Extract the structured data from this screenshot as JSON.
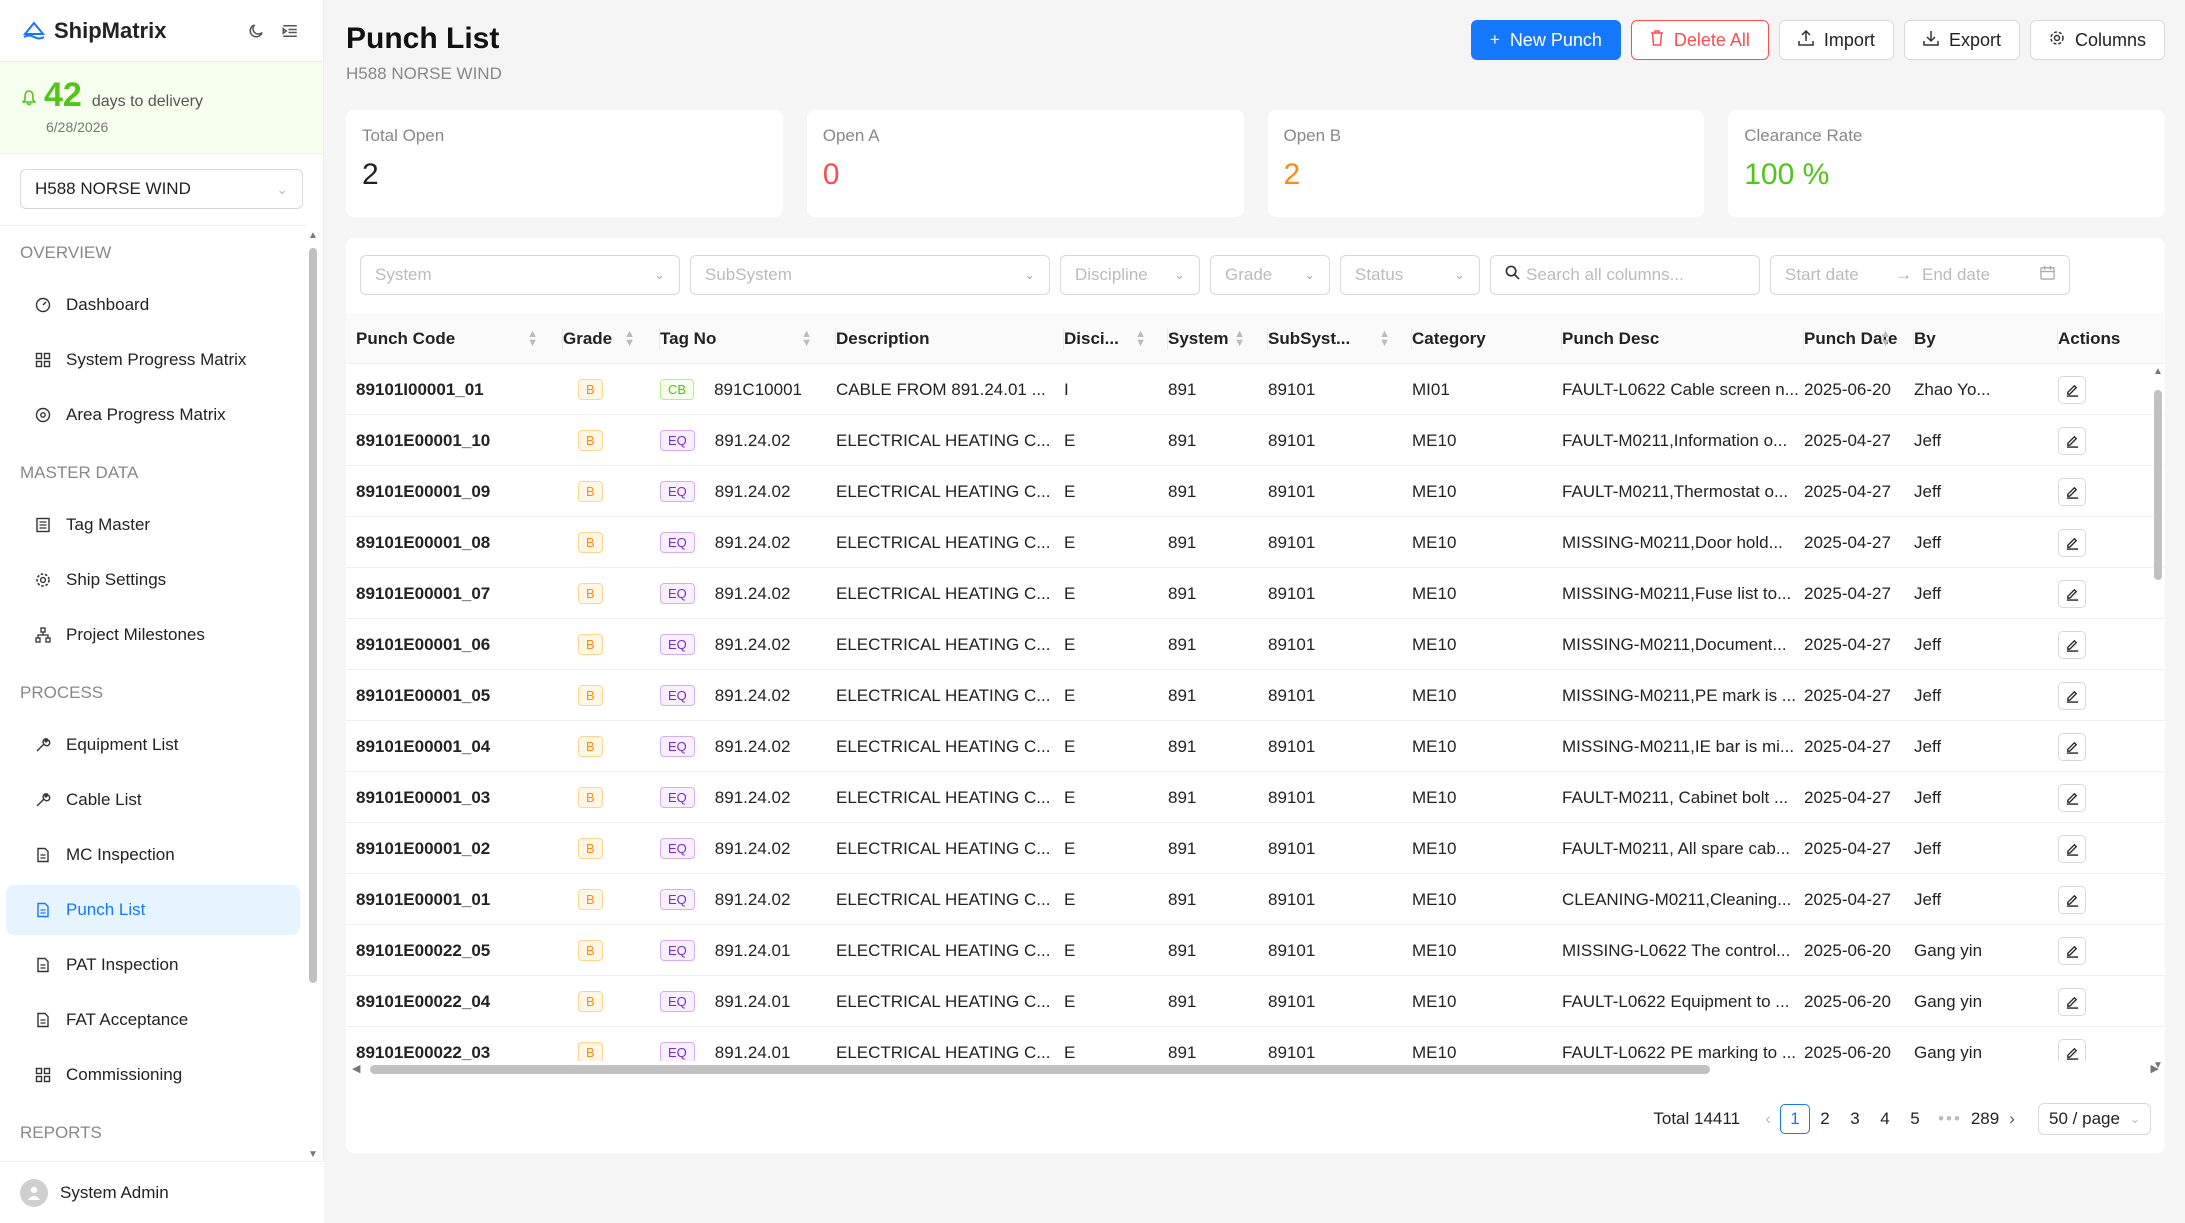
{
  "app": {
    "name": "ShipMatrix"
  },
  "delivery": {
    "days": "42",
    "label": "days to delivery",
    "date": "6/28/2026"
  },
  "ship_select": {
    "value": "H588 NORSE WIND"
  },
  "nav": {
    "sections": [
      {
        "label": "OVERVIEW",
        "items": [
          {
            "label": "Dashboard",
            "icon": "dashboard-icon"
          },
          {
            "label": "System Progress Matrix",
            "icon": "grid-icon"
          },
          {
            "label": "Area Progress Matrix",
            "icon": "location-icon"
          }
        ]
      },
      {
        "label": "MASTER DATA",
        "items": [
          {
            "label": "Tag Master",
            "icon": "list-icon"
          },
          {
            "label": "Ship Settings",
            "icon": "gear-icon"
          },
          {
            "label": "Project Milestones",
            "icon": "hierarchy-icon"
          }
        ]
      },
      {
        "label": "PROCESS",
        "items": [
          {
            "label": "Equipment List",
            "icon": "tool-icon"
          },
          {
            "label": "Cable List",
            "icon": "tool-icon"
          },
          {
            "label": "MC Inspection",
            "icon": "document-icon"
          },
          {
            "label": "Punch List",
            "icon": "document-icon",
            "active": true
          },
          {
            "label": "PAT Inspection",
            "icon": "document-icon"
          },
          {
            "label": "FAT Acceptance",
            "icon": "document-icon"
          },
          {
            "label": "Commissioning",
            "icon": "grid-icon"
          }
        ]
      },
      {
        "label": "REPORTS",
        "items": []
      }
    ]
  },
  "user": {
    "name": "System Admin"
  },
  "page": {
    "title": "Punch List",
    "subtitle": "H588 NORSE WIND"
  },
  "toolbar": {
    "new": "New Punch",
    "delete": "Delete All",
    "import": "Import",
    "export": "Export",
    "columns": "Columns"
  },
  "stats": [
    {
      "label": "Total Open",
      "value": "2",
      "color": "default"
    },
    {
      "label": "Open A",
      "value": "0",
      "color": "red"
    },
    {
      "label": "Open B",
      "value": "2",
      "color": "orange"
    },
    {
      "label": "Clearance Rate",
      "value": "100 %",
      "color": "green"
    }
  ],
  "filters": {
    "system": "System",
    "subsystem": "SubSystem",
    "discipline": "Discipline",
    "grade": "Grade",
    "status": "Status",
    "search": "Search all columns...",
    "start": "Start date",
    "end": "End date"
  },
  "columns": [
    "Punch Code",
    "Grade",
    "Tag No",
    "Description",
    "Disci...",
    "System",
    "SubSyst...",
    "Category",
    "Punch Desc",
    "Punch Date",
    "By",
    "Actions"
  ],
  "rows": [
    {
      "code": "89101I00001_01",
      "grade": "B",
      "tagtype": "CB",
      "tag": "891C10001",
      "desc": "CABLE FROM 891.24.01 ...",
      "disc": "I",
      "system": "891",
      "sub": "89101",
      "cat": "MI01",
      "pdesc": "FAULT-L0622 Cable screen n...",
      "date": "2025-06-20",
      "by": "Zhao Yo..."
    },
    {
      "code": "89101E00001_10",
      "grade": "B",
      "tagtype": "EQ",
      "tag": "891.24.02",
      "desc": "ELECTRICAL HEATING C...",
      "disc": "E",
      "system": "891",
      "sub": "89101",
      "cat": "ME10",
      "pdesc": "FAULT-M0211,Information o...",
      "date": "2025-04-27",
      "by": "Jeff"
    },
    {
      "code": "89101E00001_09",
      "grade": "B",
      "tagtype": "EQ",
      "tag": "891.24.02",
      "desc": "ELECTRICAL HEATING C...",
      "disc": "E",
      "system": "891",
      "sub": "89101",
      "cat": "ME10",
      "pdesc": "FAULT-M0211,Thermostat o...",
      "date": "2025-04-27",
      "by": "Jeff"
    },
    {
      "code": "89101E00001_08",
      "grade": "B",
      "tagtype": "EQ",
      "tag": "891.24.02",
      "desc": "ELECTRICAL HEATING C...",
      "disc": "E",
      "system": "891",
      "sub": "89101",
      "cat": "ME10",
      "pdesc": "MISSING-M0211,Door hold...",
      "date": "2025-04-27",
      "by": "Jeff"
    },
    {
      "code": "89101E00001_07",
      "grade": "B",
      "tagtype": "EQ",
      "tag": "891.24.02",
      "desc": "ELECTRICAL HEATING C...",
      "disc": "E",
      "system": "891",
      "sub": "89101",
      "cat": "ME10",
      "pdesc": "MISSING-M0211,Fuse list to...",
      "date": "2025-04-27",
      "by": "Jeff"
    },
    {
      "code": "89101E00001_06",
      "grade": "B",
      "tagtype": "EQ",
      "tag": "891.24.02",
      "desc": "ELECTRICAL HEATING C...",
      "disc": "E",
      "system": "891",
      "sub": "89101",
      "cat": "ME10",
      "pdesc": "MISSING-M0211,Document...",
      "date": "2025-04-27",
      "by": "Jeff"
    },
    {
      "code": "89101E00001_05",
      "grade": "B",
      "tagtype": "EQ",
      "tag": "891.24.02",
      "desc": "ELECTRICAL HEATING C...",
      "disc": "E",
      "system": "891",
      "sub": "89101",
      "cat": "ME10",
      "pdesc": "MISSING-M0211,PE mark is ...",
      "date": "2025-04-27",
      "by": "Jeff"
    },
    {
      "code": "89101E00001_04",
      "grade": "B",
      "tagtype": "EQ",
      "tag": "891.24.02",
      "desc": "ELECTRICAL HEATING C...",
      "disc": "E",
      "system": "891",
      "sub": "89101",
      "cat": "ME10",
      "pdesc": "MISSING-M0211,IE bar is mi...",
      "date": "2025-04-27",
      "by": "Jeff"
    },
    {
      "code": "89101E00001_03",
      "grade": "B",
      "tagtype": "EQ",
      "tag": "891.24.02",
      "desc": "ELECTRICAL HEATING C...",
      "disc": "E",
      "system": "891",
      "sub": "89101",
      "cat": "ME10",
      "pdesc": "FAULT-M0211, Cabinet bolt ...",
      "date": "2025-04-27",
      "by": "Jeff"
    },
    {
      "code": "89101E00001_02",
      "grade": "B",
      "tagtype": "EQ",
      "tag": "891.24.02",
      "desc": "ELECTRICAL HEATING C...",
      "disc": "E",
      "system": "891",
      "sub": "89101",
      "cat": "ME10",
      "pdesc": "FAULT-M0211, All spare cab...",
      "date": "2025-04-27",
      "by": "Jeff"
    },
    {
      "code": "89101E00001_01",
      "grade": "B",
      "tagtype": "EQ",
      "tag": "891.24.02",
      "desc": "ELECTRICAL HEATING C...",
      "disc": "E",
      "system": "891",
      "sub": "89101",
      "cat": "ME10",
      "pdesc": "CLEANING-M0211,Cleaning...",
      "date": "2025-04-27",
      "by": "Jeff"
    },
    {
      "code": "89101E00022_05",
      "grade": "B",
      "tagtype": "EQ",
      "tag": "891.24.01",
      "desc": "ELECTRICAL HEATING C...",
      "disc": "E",
      "system": "891",
      "sub": "89101",
      "cat": "ME10",
      "pdesc": "MISSING-L0622 The control...",
      "date": "2025-06-20",
      "by": "Gang yin"
    },
    {
      "code": "89101E00022_04",
      "grade": "B",
      "tagtype": "EQ",
      "tag": "891.24.01",
      "desc": "ELECTRICAL HEATING C...",
      "disc": "E",
      "system": "891",
      "sub": "89101",
      "cat": "ME10",
      "pdesc": "FAULT-L0622 Equipment to ...",
      "date": "2025-06-20",
      "by": "Gang yin"
    },
    {
      "code": "89101E00022_03",
      "grade": "B",
      "tagtype": "EQ",
      "tag": "891.24.01",
      "desc": "ELECTRICAL HEATING C...",
      "disc": "E",
      "system": "891",
      "sub": "89101",
      "cat": "ME10",
      "pdesc": "FAULT-L0622 PE marking to ...",
      "date": "2025-06-20",
      "by": "Gang yin"
    }
  ],
  "pagination": {
    "total": "Total 14411",
    "pages": [
      "1",
      "2",
      "3",
      "4",
      "5"
    ],
    "current": "1",
    "last": "289",
    "size": "50 / page"
  }
}
